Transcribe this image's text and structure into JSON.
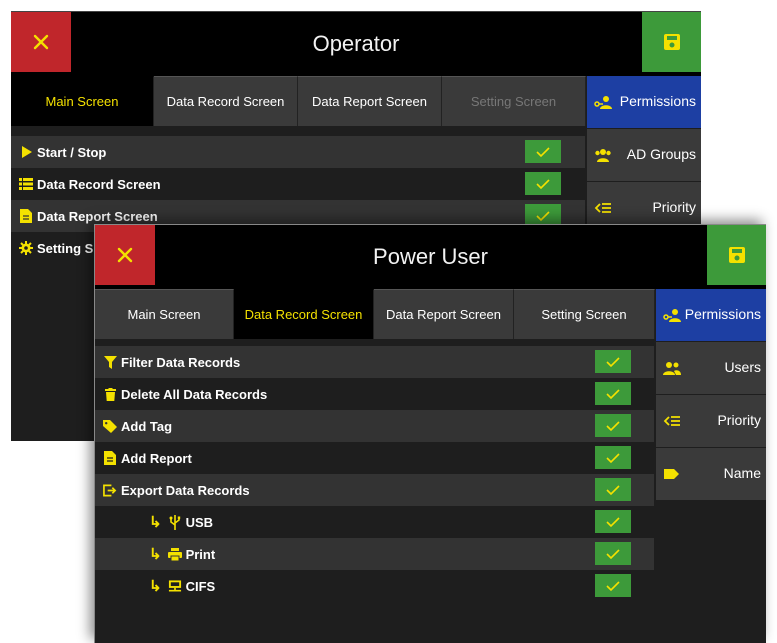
{
  "operator": {
    "title": "Operator",
    "tabs": [
      {
        "label": "Main Screen",
        "state": "active"
      },
      {
        "label": "Data Record Screen",
        "state": "normal"
      },
      {
        "label": "Data Report Screen",
        "state": "normal"
      },
      {
        "label": "Setting Screen",
        "state": "disabled"
      }
    ],
    "sidebar": [
      {
        "label": "Permissions",
        "icon": "permissions-icon",
        "active": true
      },
      {
        "label": "AD Groups",
        "icon": "group-icon",
        "active": false
      },
      {
        "label": "Priority",
        "icon": "priority-icon",
        "active": false
      }
    ],
    "rows": [
      {
        "label": "Start / Stop",
        "icon": "play-icon",
        "checked": true
      },
      {
        "label": "Data Record Screen",
        "icon": "list-icon",
        "checked": true
      },
      {
        "label": "Data Report Screen",
        "icon": "report-icon",
        "checked": true
      },
      {
        "label": "Setting S",
        "icon": "gear-icon",
        "checked": false
      }
    ]
  },
  "power_user": {
    "title": "Power User",
    "tabs": [
      {
        "label": "Main Screen",
        "state": "normal"
      },
      {
        "label": "Data Record Screen",
        "state": "active"
      },
      {
        "label": "Data Report Screen",
        "state": "normal"
      },
      {
        "label": "Setting Screen",
        "state": "normal"
      }
    ],
    "sidebar": [
      {
        "label": "Permissions",
        "icon": "permissions-icon",
        "active": true
      },
      {
        "label": "Users",
        "icon": "users-icon",
        "active": false
      },
      {
        "label": "Priority",
        "icon": "priority-icon",
        "active": false
      },
      {
        "label": "Name",
        "icon": "tag-icon",
        "active": false
      }
    ],
    "rows": [
      {
        "label": "Filter Data Records",
        "icon": "filter-icon",
        "checked": true,
        "sub": false
      },
      {
        "label": "Delete All Data Records",
        "icon": "trash-icon",
        "checked": true,
        "sub": false
      },
      {
        "label": "Add Tag",
        "icon": "tag-icon",
        "checked": true,
        "sub": false
      },
      {
        "label": "Add Report",
        "icon": "report-icon",
        "checked": true,
        "sub": false
      },
      {
        "label": "Export Data Records",
        "icon": "export-icon",
        "checked": true,
        "sub": false
      },
      {
        "label": "USB",
        "icon": "usb-icon",
        "checked": true,
        "sub": true
      },
      {
        "label": "Print",
        "icon": "printer-icon",
        "checked": true,
        "sub": true
      },
      {
        "label": "CIFS",
        "icon": "network-share-icon",
        "checked": true,
        "sub": true
      }
    ]
  },
  "colors": {
    "accent_yellow": "#f4e100",
    "check_green": "#3d9a3a",
    "close_red": "#c0262b",
    "active_blue": "#1d3fa3"
  }
}
